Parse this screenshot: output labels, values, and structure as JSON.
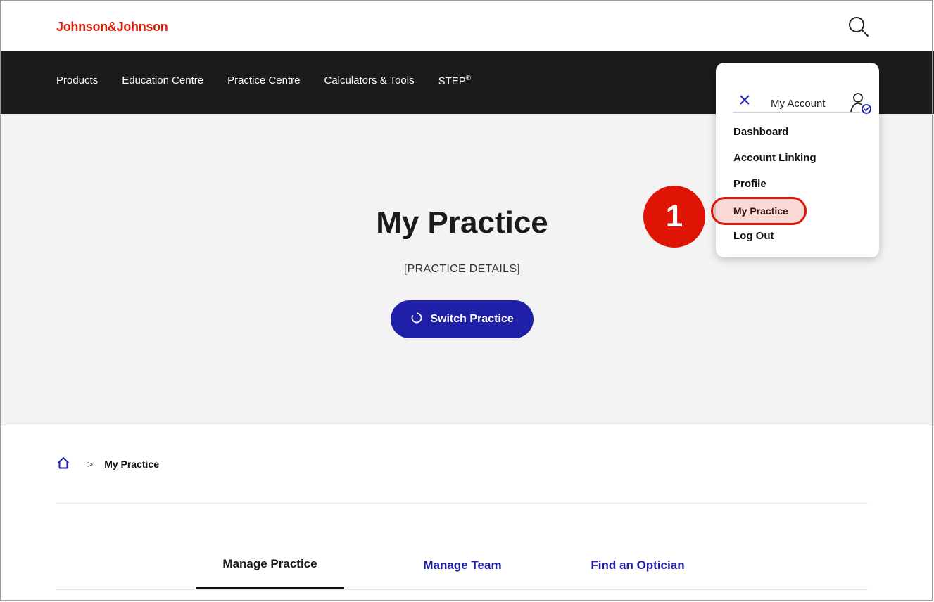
{
  "header": {
    "logo_text": "Johnson&Johnson",
    "search_icon": "search-icon",
    "brand_color": "#d81e05"
  },
  "nav": {
    "items": [
      {
        "label": "Products"
      },
      {
        "label": "Education Centre"
      },
      {
        "label": "Practice Centre"
      },
      {
        "label": "Calculators & Tools"
      },
      {
        "label": "STEP",
        "superscript": "®"
      }
    ]
  },
  "hero": {
    "title": "My Practice",
    "subtitle": "[PRACTICE DETAILS]",
    "switch_button_label": "Switch Practice",
    "switch_icon": "refresh-icon",
    "accent_color": "#1f1fa8"
  },
  "breadcrumb": {
    "home_icon": "home-icon",
    "separator": ">",
    "current": "My Practice"
  },
  "tabs": [
    {
      "label": "Manage Practice",
      "active": true
    },
    {
      "label": "Manage Team",
      "active": false
    },
    {
      "label": "Find an Optician",
      "active": false
    }
  ],
  "account_menu": {
    "close_icon": "close-icon",
    "title": "My Account",
    "user_icon": "user-check-icon",
    "items": [
      {
        "label": "Dashboard"
      },
      {
        "label": "Account Linking"
      },
      {
        "label": "Profile"
      },
      {
        "label": "My Practice",
        "highlighted": true
      },
      {
        "label": "Log Out"
      }
    ]
  },
  "annotation": {
    "step_number": "1",
    "color": "#e01405"
  }
}
